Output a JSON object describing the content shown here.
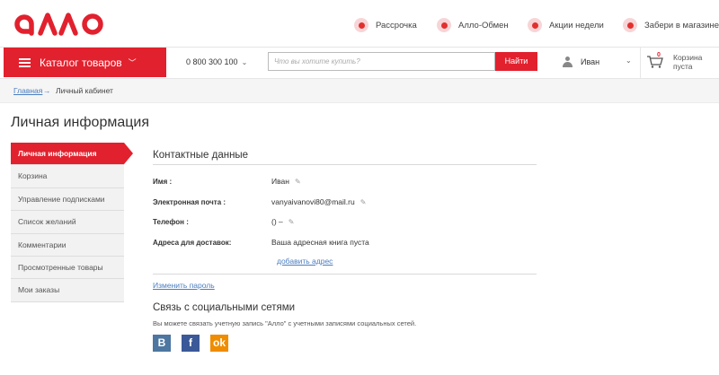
{
  "brand": {
    "name": "алло",
    "color": "#e2212e"
  },
  "top_links": [
    {
      "label": "Рассрочка",
      "icon": "installment-icon"
    },
    {
      "label": "Алло-Обмен",
      "icon": "exchange-icon"
    },
    {
      "label": "Акции недели",
      "icon": "promo-icon"
    },
    {
      "label": "Забери в магазине",
      "icon": "location-icon"
    }
  ],
  "nav": {
    "catalog_label": "Каталог товаров",
    "phone": "0 800 300 100",
    "phone_chevron": "⌄",
    "search_placeholder": "Что вы хотите купить?",
    "search_button": "Найти",
    "user_name": "Иван",
    "cart_count": "0",
    "cart_label": "Корзина пуста"
  },
  "breadcrumb": {
    "home": "Главная",
    "separator": "→",
    "current": "Личный кабинет"
  },
  "page_title": "Личная информация",
  "sidebar": {
    "items": [
      {
        "label": "Личная информация",
        "active": true
      },
      {
        "label": "Корзина"
      },
      {
        "label": "Управление подписками"
      },
      {
        "label": "Список желаний"
      },
      {
        "label": "Комментарии"
      },
      {
        "label": "Просмотренные товары"
      },
      {
        "label": "Мои заказы"
      }
    ]
  },
  "contact": {
    "title": "Контактные данные",
    "name_label": "Имя :",
    "name_value": "Иван",
    "email_label": "Электронная почта :",
    "email_value": "vanyaivanovi80@mail.ru",
    "phone_label": "Телефон :",
    "phone_value": "() –",
    "address_label": "Адреса для доставок:",
    "address_value": "Ваша адресная книга пуста",
    "add_address": "добавить адрес",
    "change_password": "Изменить пароль"
  },
  "social": {
    "title": "Связь с социальными сетями",
    "description": "Вы можете связать учетную запись \"Алло\" с учетными записями социальных сетей.",
    "vk": "В",
    "fb": "f",
    "ok": "ok"
  }
}
